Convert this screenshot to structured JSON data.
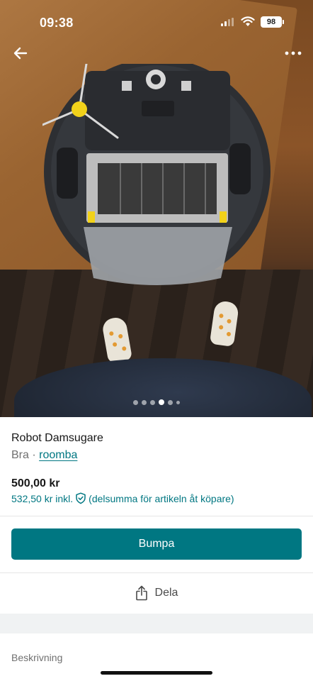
{
  "status_bar": {
    "time": "09:38",
    "battery": "98"
  },
  "navigation": {
    "back_icon": "arrow-left-icon",
    "more_icon": "more-horizontal-icon"
  },
  "gallery": {
    "photo_count": 6,
    "active_index": 3
  },
  "item": {
    "title": "Robot Damsugare",
    "condition": "Bra",
    "separator": " · ",
    "brand": "roomba",
    "price": "500,00 kr",
    "price_incl": "532,50 kr inkl.",
    "price_incl_note": "(delsumma för artikeln åt köpare)",
    "protection_icon": "shield-check-icon"
  },
  "actions": {
    "bump_label": "Bumpa",
    "share_label": "Dela",
    "share_icon": "share-icon"
  },
  "description": {
    "label": "Beskrivning"
  },
  "colors": {
    "accent": "#007782",
    "text": "#171717",
    "muted": "#707070"
  }
}
